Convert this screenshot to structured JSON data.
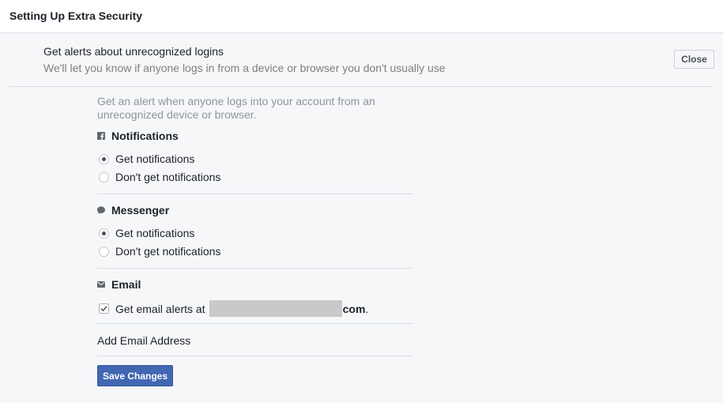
{
  "header": {
    "title": "Setting Up Extra Security"
  },
  "section": {
    "title": "Get alerts about unrecognized logins",
    "description": "We'll let you know if anyone logs in from a device or browser you don't usually use",
    "close_label": "Close"
  },
  "intro": "Get an alert when anyone logs into your account from an unrecognized device or browser.",
  "notifications": {
    "title": "Notifications",
    "icon": "facebook-icon",
    "options": [
      {
        "label": "Get notifications",
        "selected": true
      },
      {
        "label": "Don't get notifications",
        "selected": false
      }
    ]
  },
  "messenger": {
    "title": "Messenger",
    "icon": "chat-bubble-icon",
    "options": [
      {
        "label": "Get notifications",
        "selected": true
      },
      {
        "label": "Don't get notifications",
        "selected": false
      }
    ]
  },
  "email": {
    "title": "Email",
    "icon": "envelope-icon",
    "alert_prefix": "Get email alerts at",
    "alert_suffix": "com",
    "period": ".",
    "checked": true
  },
  "add_email_label": "Add Email Address",
  "save_label": "Save Changes",
  "colors": {
    "primary_button": "#4267b2",
    "header_bg": "#ffffff",
    "page_bg": "#f6f7f9"
  }
}
